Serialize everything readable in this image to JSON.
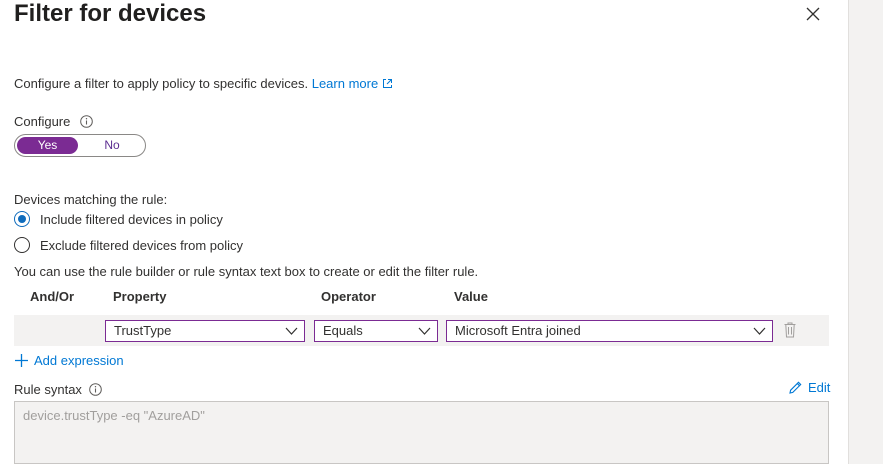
{
  "panel": {
    "title": "Filter for devices",
    "description": "Configure a filter to apply policy to specific devices.",
    "learn_more": "Learn more"
  },
  "configure": {
    "label": "Configure",
    "yes": "Yes",
    "no": "No",
    "selected": "Yes"
  },
  "matching": {
    "label": "Devices matching the rule:",
    "options": [
      {
        "label": "Include filtered devices in policy",
        "selected": true
      },
      {
        "label": "Exclude filtered devices from policy",
        "selected": false
      }
    ]
  },
  "rule_builder": {
    "hint": "You can use the rule builder or rule syntax text box to create or edit the filter rule.",
    "headers": {
      "andor": "And/Or",
      "property": "Property",
      "operator": "Operator",
      "value": "Value"
    },
    "rows": [
      {
        "property": "TrustType",
        "operator": "Equals",
        "value": "Microsoft Entra joined"
      }
    ],
    "add_expression": "Add expression"
  },
  "rule_syntax": {
    "label": "Rule syntax",
    "edit": "Edit",
    "text": "device.trustType -eq \"AzureAD\""
  },
  "colors": {
    "accent": "#7b2b93",
    "link": "#0078d4",
    "radio": "#0f6cbd"
  },
  "icons": [
    "close-icon",
    "external-link-icon",
    "info-icon",
    "chevron-down-icon",
    "trash-icon",
    "plus-icon",
    "pencil-icon"
  ]
}
